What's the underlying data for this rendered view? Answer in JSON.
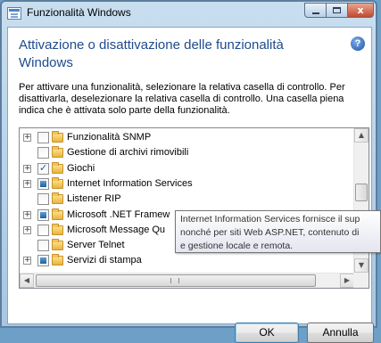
{
  "window": {
    "title": "Funzionalità Windows",
    "controls": {
      "minimize": "minimize",
      "maximize": "maximize",
      "close": "x"
    }
  },
  "content": {
    "heading": "Attivazione o disattivazione delle funzionalità Windows",
    "help_glyph": "?",
    "description": "Per attivare una funzionalità, selezionare la relativa casella di controllo. Per disattivarla, deselezionare la relativa casella di controllo. Una casella piena indica che è attivata solo parte della funzionalità."
  },
  "features": [
    {
      "label": "Funzionalità SNMP",
      "expandable": true,
      "state": "unchecked"
    },
    {
      "label": "Gestione di archivi rimovibili",
      "expandable": false,
      "state": "unchecked"
    },
    {
      "label": "Giochi",
      "expandable": true,
      "state": "checked"
    },
    {
      "label": "Internet Information Services",
      "expandable": true,
      "state": "partial"
    },
    {
      "label": "Listener RIP",
      "expandable": false,
      "state": "unchecked"
    },
    {
      "label": "Microsoft .NET Framew",
      "expandable": true,
      "state": "partial"
    },
    {
      "label": "Microsoft Message Qu",
      "expandable": true,
      "state": "unchecked"
    },
    {
      "label": "Server Telnet",
      "expandable": false,
      "state": "unchecked"
    },
    {
      "label": "Servizi di stampa",
      "expandable": true,
      "state": "partial"
    }
  ],
  "tooltip": {
    "lines": [
      "Internet Information Services fornisce il sup",
      "nonché per siti Web ASP.NET, contenuto di",
      "e gestione locale e remota."
    ]
  },
  "buttons": {
    "ok": "OK",
    "cancel": "Annulla"
  },
  "glyphs": {
    "expand": "+",
    "check": "✓",
    "scroll_up": "▲",
    "scroll_down": "▼",
    "scroll_left": "◀",
    "scroll_right": "▶"
  }
}
